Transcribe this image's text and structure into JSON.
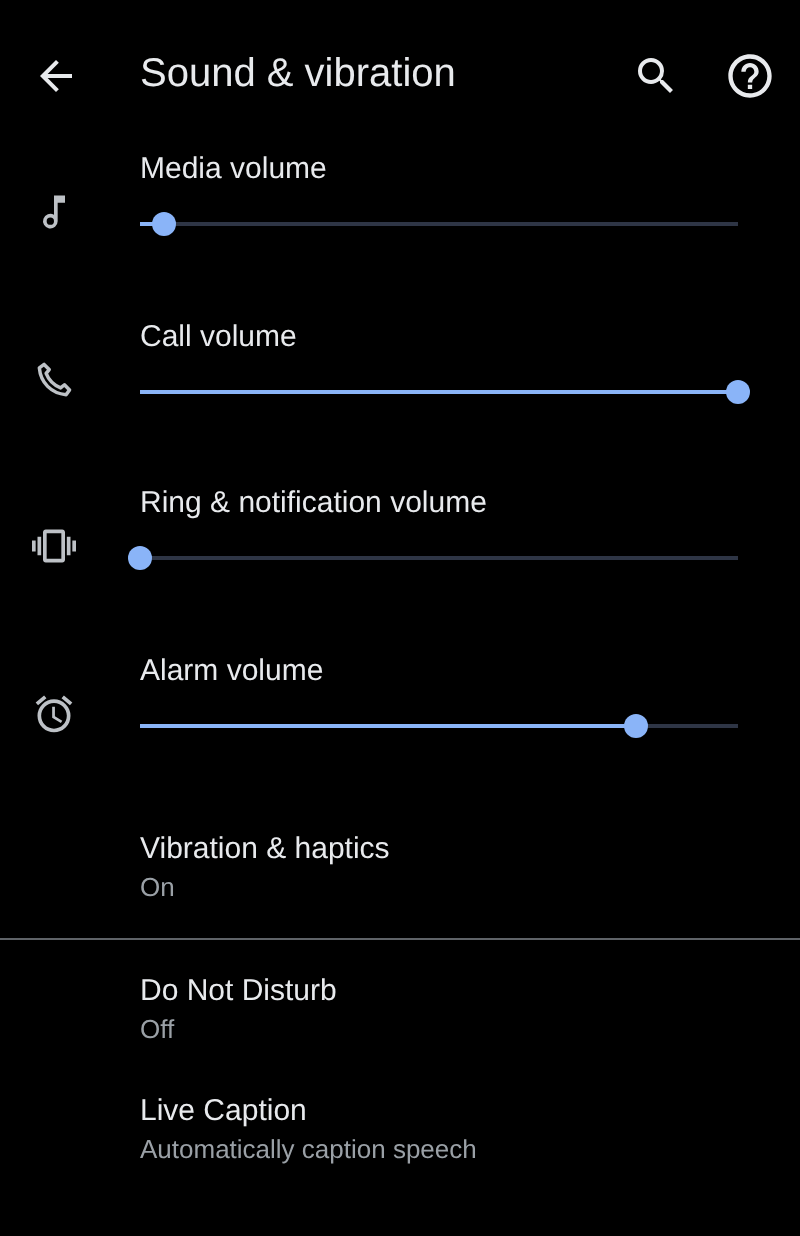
{
  "header": {
    "title": "Sound & vibration"
  },
  "sections": [
    {
      "items": [
        {
          "kind": "slider",
          "title": "Media volume",
          "level": 0.04
        },
        {
          "kind": "slider",
          "title": "Call volume",
          "level": 1.0
        },
        {
          "kind": "slider",
          "title": "Ring & notification volume",
          "level": 0.0
        },
        {
          "kind": "slider",
          "title": "Alarm volume",
          "level": 0.83
        },
        {
          "kind": "setting",
          "title": "Vibration & haptics",
          "summary": "On"
        }
      ]
    },
    {
      "items": [
        {
          "kind": "setting",
          "title": "Do Not Disturb",
          "summary": "Off"
        },
        {
          "kind": "setting",
          "title": "Live Caption",
          "summary": "Automatically caption speech"
        }
      ]
    }
  ]
}
